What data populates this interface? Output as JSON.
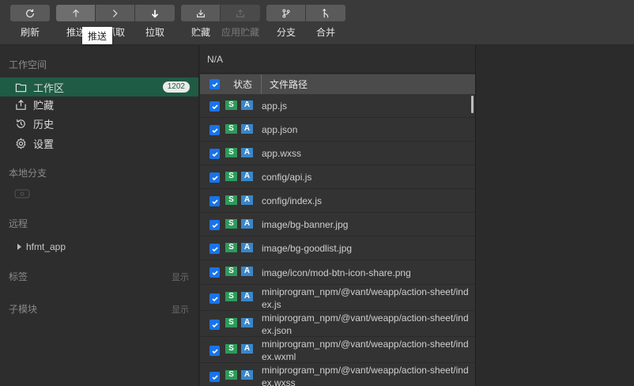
{
  "toolbar": {
    "buttons": [
      {
        "label": "刷新",
        "icon": "refresh-icon"
      },
      {
        "label": "推送",
        "icon": "push-icon"
      },
      {
        "label": "抓取",
        "icon": "fetch-icon"
      },
      {
        "label": "拉取",
        "icon": "pull-icon"
      },
      {
        "label": "贮藏",
        "icon": "stash-icon"
      },
      {
        "label": "应用贮藏",
        "icon": "apply-stash-icon"
      },
      {
        "label": "分支",
        "icon": "branch-icon"
      },
      {
        "label": "合并",
        "icon": "merge-icon"
      }
    ],
    "tooltip": "推送"
  },
  "sidebar": {
    "workspace_title": "工作空间",
    "items": [
      {
        "label": "工作区",
        "icon": "folder-icon",
        "badge": "1202"
      },
      {
        "label": "贮藏",
        "icon": "stash-icon"
      },
      {
        "label": "历史",
        "icon": "history-icon"
      },
      {
        "label": "设置",
        "icon": "gear-icon"
      }
    ],
    "local_branch_title": "本地分支",
    "remote_title": "远程",
    "remote_item": "hfmt_app",
    "tags_title": "标签",
    "tags_show": "显示",
    "submodules_title": "子模块",
    "submodules_show": "显示"
  },
  "main": {
    "branch": "N/A",
    "header": {
      "status": "状态",
      "path": "文件路径"
    },
    "status_tags": {
      "s": "S",
      "a": "A"
    },
    "files": [
      "app.js",
      "app.json",
      "app.wxss",
      "config/api.js",
      "config/index.js",
      "image/bg-banner.jpg",
      "image/bg-goodlist.jpg",
      "image/icon/mod-btn-icon-share.png",
      "miniprogram_npm/@vant/weapp/action-sheet/index.js",
      "miniprogram_npm/@vant/weapp/action-sheet/index.json",
      "miniprogram_npm/@vant/weapp/action-sheet/index.wxml",
      "miniprogram_npm/@vant/weapp/action-sheet/index.wxss"
    ]
  },
  "colors": {
    "accent": "#1a73e8",
    "selected_bg": "#1f5c45",
    "tag_s": "#2e9a5a",
    "tag_a": "#3a86c8"
  }
}
